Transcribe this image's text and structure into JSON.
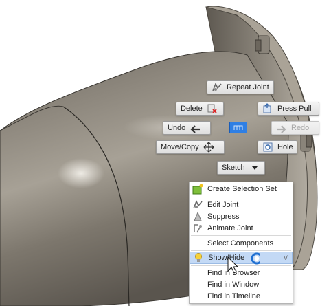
{
  "marking_menu": {
    "repeat_joint": "Repeat Joint",
    "delete": "Delete",
    "press_pull": "Press Pull",
    "undo": "Undo",
    "redo": "Redo",
    "move_copy": "Move/Copy",
    "hole": "Hole",
    "sketch": "Sketch"
  },
  "context_menu": {
    "items": [
      {
        "label": "Create Selection Set",
        "icon": "selection-set-icon"
      },
      {
        "label": "Edit Joint",
        "icon": "edit-joint-icon"
      },
      {
        "label": "Suppress",
        "icon": "suppress-icon"
      },
      {
        "label": "Animate Joint",
        "icon": "animate-joint-icon"
      },
      {
        "label": "Select Components",
        "icon": ""
      },
      {
        "label": "Show/Hide",
        "icon": "lightbulb-icon",
        "shortcut": "V"
      },
      {
        "label": "Find in Browser",
        "icon": ""
      },
      {
        "label": "Find in Window",
        "icon": ""
      },
      {
        "label": "Find in Timeline",
        "icon": ""
      }
    ]
  },
  "colors": {
    "highlight": "#c3d9f5",
    "center_button": "#2f7fe4",
    "model_metal": "#8f877b"
  }
}
